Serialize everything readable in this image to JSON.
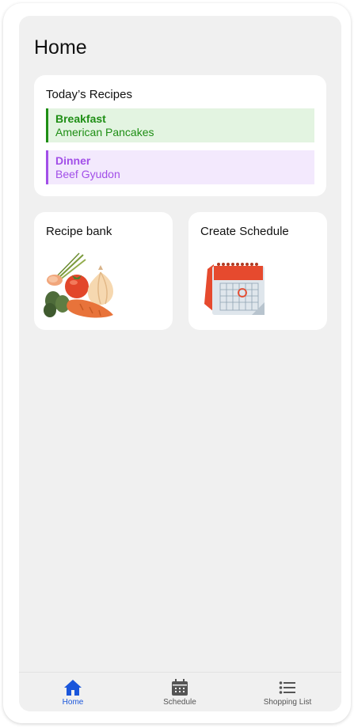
{
  "page": {
    "title": "Home"
  },
  "todays_recipes": {
    "title": "Today’s Recipes",
    "meals": [
      {
        "type": "Breakfast",
        "name": "American Pancakes",
        "color": "#1e8e14",
        "bg": "#e3f4e1"
      },
      {
        "type": "Dinner",
        "name": "Beef Gyudon",
        "color": "#a24fe8",
        "bg": "#f3e9fd"
      }
    ]
  },
  "tiles": {
    "recipe_bank": {
      "label": "Recipe bank",
      "icon": "vegetables-illustration"
    },
    "create_schedule": {
      "label": "Create Schedule",
      "icon": "calendar-illustration"
    }
  },
  "nav": {
    "active": "Home",
    "accent": "#1a56db",
    "items": [
      {
        "label": "Home",
        "icon": "home-icon"
      },
      {
        "label": "Schedule",
        "icon": "calendar-icon"
      },
      {
        "label": "Shopping List",
        "icon": "list-icon"
      }
    ]
  }
}
